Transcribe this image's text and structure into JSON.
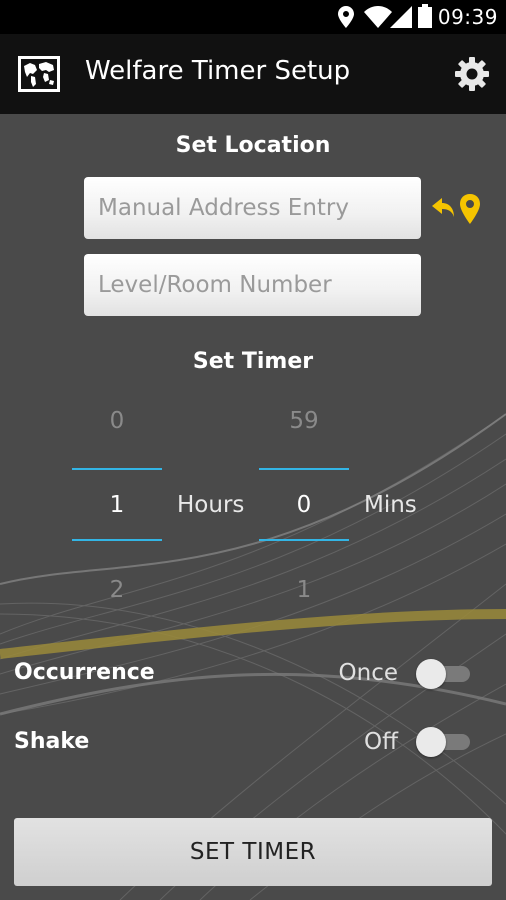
{
  "status_bar": {
    "time": "09:39",
    "icons": [
      "location-icon",
      "wifi-icon",
      "signal-icon",
      "battery-icon"
    ]
  },
  "action_bar": {
    "title": "Welfare Timer Setup",
    "app_icon": "world-map-icon",
    "settings_icon": "gear-icon"
  },
  "location": {
    "heading": "Set Location",
    "address_placeholder": "Manual Address Entry",
    "address_value": "",
    "room_placeholder": "Level/Room Number",
    "room_value": "",
    "locate_icon": "reply-location-pin-icon"
  },
  "timer": {
    "heading": "Set Timer",
    "hours": {
      "prev": "0",
      "value": "1",
      "next": "2",
      "unit": "Hours"
    },
    "minutes": {
      "prev": "59",
      "value": "0",
      "next": "1",
      "unit": "Mins"
    }
  },
  "occurrence": {
    "label": "Occurrence",
    "value": "Once",
    "enabled": false
  },
  "shake": {
    "label": "Shake",
    "value": "Off",
    "enabled": false
  },
  "set_timer_button": "SET TIMER",
  "colors": {
    "background": "#4a4a4a",
    "action_bar": "#111111",
    "accent_blue": "#33b5e5",
    "accent_yellow": "#f5c400"
  }
}
